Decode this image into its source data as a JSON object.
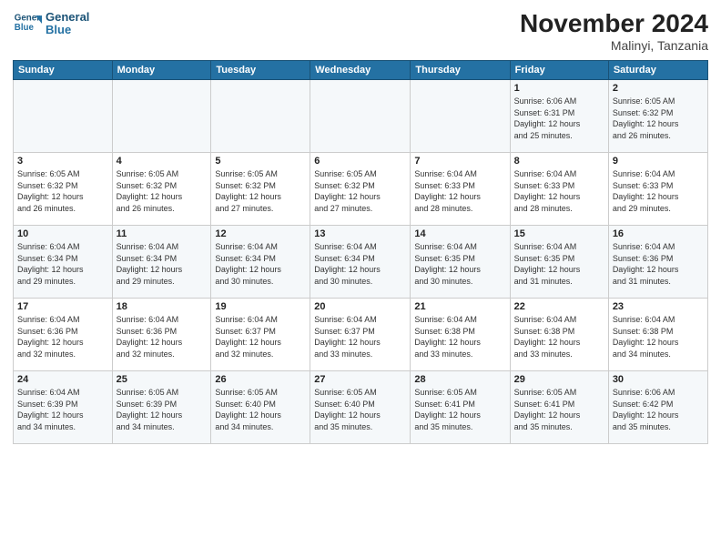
{
  "logo": {
    "line1": "General",
    "line2": "Blue"
  },
  "title": "November 2024",
  "location": "Malinyi, Tanzania",
  "days_of_week": [
    "Sunday",
    "Monday",
    "Tuesday",
    "Wednesday",
    "Thursday",
    "Friday",
    "Saturday"
  ],
  "weeks": [
    [
      {
        "num": "",
        "info": ""
      },
      {
        "num": "",
        "info": ""
      },
      {
        "num": "",
        "info": ""
      },
      {
        "num": "",
        "info": ""
      },
      {
        "num": "",
        "info": ""
      },
      {
        "num": "1",
        "info": "Sunrise: 6:06 AM\nSunset: 6:31 PM\nDaylight: 12 hours\nand 25 minutes."
      },
      {
        "num": "2",
        "info": "Sunrise: 6:05 AM\nSunset: 6:32 PM\nDaylight: 12 hours\nand 26 minutes."
      }
    ],
    [
      {
        "num": "3",
        "info": "Sunrise: 6:05 AM\nSunset: 6:32 PM\nDaylight: 12 hours\nand 26 minutes."
      },
      {
        "num": "4",
        "info": "Sunrise: 6:05 AM\nSunset: 6:32 PM\nDaylight: 12 hours\nand 26 minutes."
      },
      {
        "num": "5",
        "info": "Sunrise: 6:05 AM\nSunset: 6:32 PM\nDaylight: 12 hours\nand 27 minutes."
      },
      {
        "num": "6",
        "info": "Sunrise: 6:05 AM\nSunset: 6:32 PM\nDaylight: 12 hours\nand 27 minutes."
      },
      {
        "num": "7",
        "info": "Sunrise: 6:04 AM\nSunset: 6:33 PM\nDaylight: 12 hours\nand 28 minutes."
      },
      {
        "num": "8",
        "info": "Sunrise: 6:04 AM\nSunset: 6:33 PM\nDaylight: 12 hours\nand 28 minutes."
      },
      {
        "num": "9",
        "info": "Sunrise: 6:04 AM\nSunset: 6:33 PM\nDaylight: 12 hours\nand 29 minutes."
      }
    ],
    [
      {
        "num": "10",
        "info": "Sunrise: 6:04 AM\nSunset: 6:34 PM\nDaylight: 12 hours\nand 29 minutes."
      },
      {
        "num": "11",
        "info": "Sunrise: 6:04 AM\nSunset: 6:34 PM\nDaylight: 12 hours\nand 29 minutes."
      },
      {
        "num": "12",
        "info": "Sunrise: 6:04 AM\nSunset: 6:34 PM\nDaylight: 12 hours\nand 30 minutes."
      },
      {
        "num": "13",
        "info": "Sunrise: 6:04 AM\nSunset: 6:34 PM\nDaylight: 12 hours\nand 30 minutes."
      },
      {
        "num": "14",
        "info": "Sunrise: 6:04 AM\nSunset: 6:35 PM\nDaylight: 12 hours\nand 30 minutes."
      },
      {
        "num": "15",
        "info": "Sunrise: 6:04 AM\nSunset: 6:35 PM\nDaylight: 12 hours\nand 31 minutes."
      },
      {
        "num": "16",
        "info": "Sunrise: 6:04 AM\nSunset: 6:36 PM\nDaylight: 12 hours\nand 31 minutes."
      }
    ],
    [
      {
        "num": "17",
        "info": "Sunrise: 6:04 AM\nSunset: 6:36 PM\nDaylight: 12 hours\nand 32 minutes."
      },
      {
        "num": "18",
        "info": "Sunrise: 6:04 AM\nSunset: 6:36 PM\nDaylight: 12 hours\nand 32 minutes."
      },
      {
        "num": "19",
        "info": "Sunrise: 6:04 AM\nSunset: 6:37 PM\nDaylight: 12 hours\nand 32 minutes."
      },
      {
        "num": "20",
        "info": "Sunrise: 6:04 AM\nSunset: 6:37 PM\nDaylight: 12 hours\nand 33 minutes."
      },
      {
        "num": "21",
        "info": "Sunrise: 6:04 AM\nSunset: 6:38 PM\nDaylight: 12 hours\nand 33 minutes."
      },
      {
        "num": "22",
        "info": "Sunrise: 6:04 AM\nSunset: 6:38 PM\nDaylight: 12 hours\nand 33 minutes."
      },
      {
        "num": "23",
        "info": "Sunrise: 6:04 AM\nSunset: 6:38 PM\nDaylight: 12 hours\nand 34 minutes."
      }
    ],
    [
      {
        "num": "24",
        "info": "Sunrise: 6:04 AM\nSunset: 6:39 PM\nDaylight: 12 hours\nand 34 minutes."
      },
      {
        "num": "25",
        "info": "Sunrise: 6:05 AM\nSunset: 6:39 PM\nDaylight: 12 hours\nand 34 minutes."
      },
      {
        "num": "26",
        "info": "Sunrise: 6:05 AM\nSunset: 6:40 PM\nDaylight: 12 hours\nand 34 minutes."
      },
      {
        "num": "27",
        "info": "Sunrise: 6:05 AM\nSunset: 6:40 PM\nDaylight: 12 hours\nand 35 minutes."
      },
      {
        "num": "28",
        "info": "Sunrise: 6:05 AM\nSunset: 6:41 PM\nDaylight: 12 hours\nand 35 minutes."
      },
      {
        "num": "29",
        "info": "Sunrise: 6:05 AM\nSunset: 6:41 PM\nDaylight: 12 hours\nand 35 minutes."
      },
      {
        "num": "30",
        "info": "Sunrise: 6:06 AM\nSunset: 6:42 PM\nDaylight: 12 hours\nand 35 minutes."
      }
    ]
  ]
}
